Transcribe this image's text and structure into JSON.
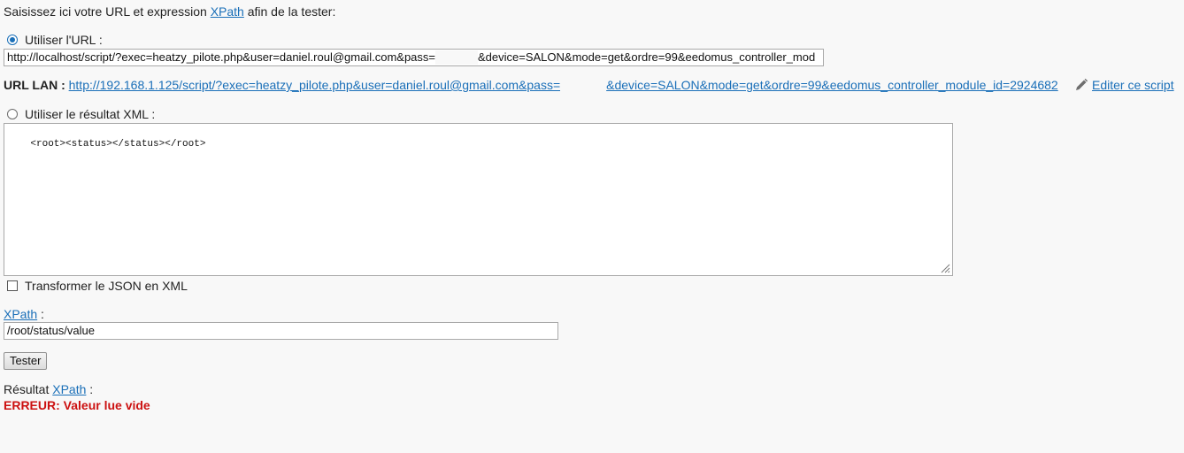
{
  "intro": {
    "prefix": "Saisissez ici votre URL et expression",
    "xpath_link": "XPath",
    "suffix": "afin de la tester:"
  },
  "url_option": {
    "label": "Utiliser l'URL :",
    "selected": true,
    "value": "http://localhost/script/?exec=heatzy_pilote.php&user=daniel.roul@gmail.com&pass=",
    "value_after_redaction": "&device=SALON&mode=get&ordre=99&eedomus_controller_mod"
  },
  "url_lan": {
    "label": "URL LAN :",
    "link_start": "http://192.168.1.125/script/?exec=heatzy_pilote.php&user=daniel.roul@gmail.com&pass=",
    "link_end": "&device=SALON&mode=get&ordre=99&eedomus_controller_module_id=2924682",
    "edit_label": "Editer ce script",
    "edit_icon": "pencil-icon"
  },
  "xml_option": {
    "label": "Utiliser le résultat XML :",
    "selected": false,
    "content": "<root><status></status></root>"
  },
  "json_transform": {
    "label": "Transformer le JSON en XML",
    "checked": false
  },
  "xpath": {
    "link": "XPath",
    "suffix": ":",
    "value": "/root/status/value"
  },
  "test_button": {
    "label": "Tester"
  },
  "result": {
    "prefix": "Résultat",
    "link": "XPath",
    "suffix": ":",
    "error": "ERREUR: Valeur lue vide"
  },
  "colors": {
    "link": "#1a6fb8",
    "error": "#cc1111",
    "background": "#f8f8f8"
  }
}
